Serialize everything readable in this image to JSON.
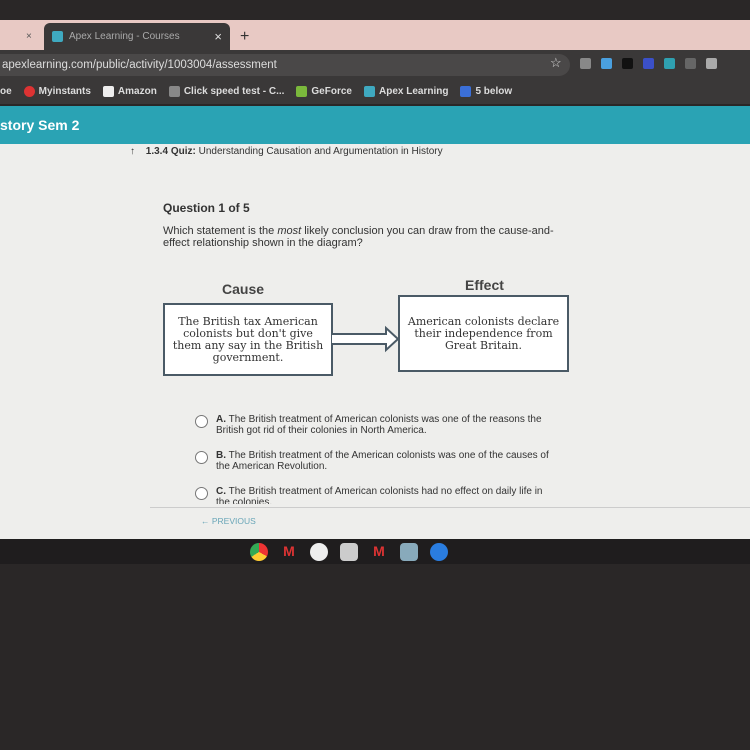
{
  "browser": {
    "tabs": [
      {
        "label": "Apex Learning - Courses",
        "close": "×"
      }
    ],
    "prev_tab_close": "×",
    "new_tab": "+",
    "url": "apexlearning.com/public/activity/1003004/assessment",
    "bookmarks": [
      {
        "label": "oe",
        "icon": "partial",
        "color": "#3a3838"
      },
      {
        "label": "Myinstants",
        "icon": "myinstants-icon",
        "color": "#d33"
      },
      {
        "label": "Amazon",
        "icon": "amazon-icon",
        "color": "#eee"
      },
      {
        "label": "Click speed test - C...",
        "icon": "cursor-icon",
        "color": "#888"
      },
      {
        "label": "GeForce",
        "icon": "geforce-icon",
        "color": "#7bb93c"
      },
      {
        "label": "Apex Learning",
        "icon": "apex-icon",
        "color": "#3fa9c0"
      },
      {
        "label": "5 below",
        "icon": "five-below-icon",
        "color": "#3b6fd8"
      }
    ]
  },
  "banner": {
    "title": "story Sem 2",
    "color": "#2aa3b4"
  },
  "breadcrumb": {
    "code": "1.3.4",
    "type": "Quiz:",
    "title": "Understanding Causation and Argumentation in History"
  },
  "question": {
    "counter": "Question 1 of 5",
    "prompt_before": "Which statement is the ",
    "prompt_em": "most",
    "prompt_after": " likely conclusion you can draw from the cause-and-effect relationship shown in the diagram?",
    "diagram": {
      "cause_label": "Cause",
      "cause_text": "The British tax American colonists but don't give them any say in the British government.",
      "effect_label": "Effect",
      "effect_text": "American colonists declare their independence from Great Britain."
    },
    "options": [
      {
        "letter": "A.",
        "text": "The British treatment of American colonists was one of the reasons the British got rid of their colonies in North America."
      },
      {
        "letter": "B.",
        "text": "The British treatment of the American colonists was one of the causes of the American Revolution."
      },
      {
        "letter": "C.",
        "text": "The British treatment of American colonists had no effect on daily life in the colonies."
      }
    ]
  },
  "nav": {
    "previous": "← PREVIOUS"
  },
  "taskbar": [
    "chrome-icon",
    "gmail-icon",
    "settings-icon",
    "files-icon",
    "gmail-icon",
    "apps-icon",
    "meet-icon"
  ]
}
